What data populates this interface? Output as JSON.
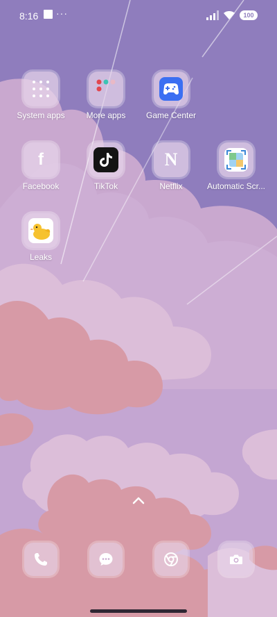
{
  "status_bar": {
    "time": "8:16",
    "dots": "···",
    "battery": "100"
  },
  "apps": [
    {
      "label": "System apps",
      "icon": "folder-grid-icon"
    },
    {
      "label": "More apps",
      "icon": "folder-icon"
    },
    {
      "label": "Game Center",
      "icon": "gamepad-icon"
    },
    {
      "label": "Facebook",
      "icon": "facebook-icon"
    },
    {
      "label": "TikTok",
      "icon": "tiktok-icon"
    },
    {
      "label": "Netflix",
      "icon": "netflix-icon"
    },
    {
      "label": "Automatic Scr...",
      "icon": "screenshot-app-icon"
    },
    {
      "label": "Leaks",
      "icon": "duck-icon"
    }
  ],
  "dock": [
    {
      "icon": "phone-icon"
    },
    {
      "icon": "messages-icon"
    },
    {
      "icon": "chrome-icon"
    },
    {
      "icon": "camera-icon"
    }
  ],
  "colors": {
    "sky": "#8f7dbd",
    "cloud_light": "#c9a8cf",
    "cloud_pale": "#dcbed9",
    "cloud_pink": "#d79aa6",
    "lower_bg": "#c4a6d2",
    "game_center": "#3b6ff2",
    "tiktok_bg": "#141414"
  }
}
